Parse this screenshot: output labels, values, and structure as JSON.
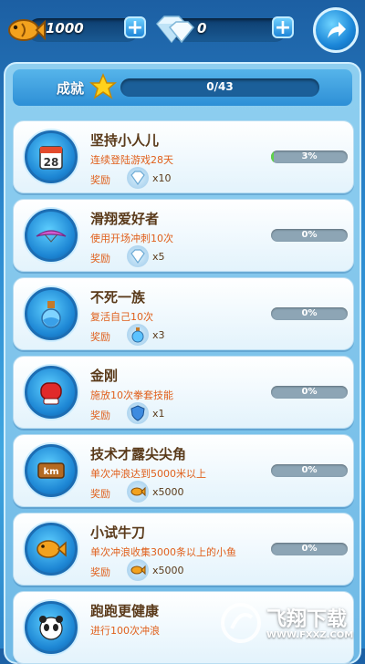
{
  "top": {
    "coins": "1000",
    "gems": "0",
    "plus": "+"
  },
  "achievements": {
    "title": "成就",
    "progress_text": "0/43",
    "progress": 0
  },
  "items": [
    {
      "title": "坚持小人儿",
      "desc": "连续登陆游戏28天",
      "reward_label": "奖励",
      "reward_icon": "gem-icon",
      "reward_qty": "x10",
      "progress_text": "3%",
      "progress": 3,
      "badge_icon": "calendar-icon",
      "badge_text": "28"
    },
    {
      "title": "滑翔爱好者",
      "desc": "使用开场冲刺10次",
      "reward_label": "奖励",
      "reward_icon": "gem-icon",
      "reward_qty": "x5",
      "progress_text": "0%",
      "progress": 0,
      "badge_icon": "glider-icon"
    },
    {
      "title": "不死一族",
      "desc": "复活自己10次",
      "reward_label": "奖励",
      "reward_icon": "potion-icon",
      "reward_qty": "x3",
      "progress_text": "0%",
      "progress": 0,
      "badge_icon": "potion-icon"
    },
    {
      "title": "金刚",
      "desc": "施放10次拳套技能",
      "reward_label": "奖励",
      "reward_icon": "shield-icon",
      "reward_qty": "x1",
      "progress_text": "0%",
      "progress": 0,
      "badge_icon": "boxing-glove-icon"
    },
    {
      "title": "技术才露尖尖角",
      "desc": "单次冲浪达到5000米以上",
      "reward_label": "奖励",
      "reward_icon": "fish-icon",
      "reward_qty": "x5000",
      "progress_text": "0%",
      "progress": 0,
      "badge_icon": "km-sign-icon",
      "badge_text": "km"
    },
    {
      "title": "小试牛刀",
      "desc": "单次冲浪收集3000条以上的小鱼",
      "reward_label": "奖励",
      "reward_icon": "fish-icon",
      "reward_qty": "x5000",
      "progress_text": "0%",
      "progress": 0,
      "badge_icon": "fish-icon"
    },
    {
      "title": "跑跑更健康",
      "desc": "进行100次冲浪",
      "badge_icon": "panda-icon"
    }
  ],
  "watermark": {
    "text": "飞翔下载",
    "url": "WWW.FXXZ.COM"
  },
  "colors": {
    "title_brown": "#5a3a1a",
    "desc_orange": "#e0601c",
    "progress_green": "#5ed24a"
  }
}
